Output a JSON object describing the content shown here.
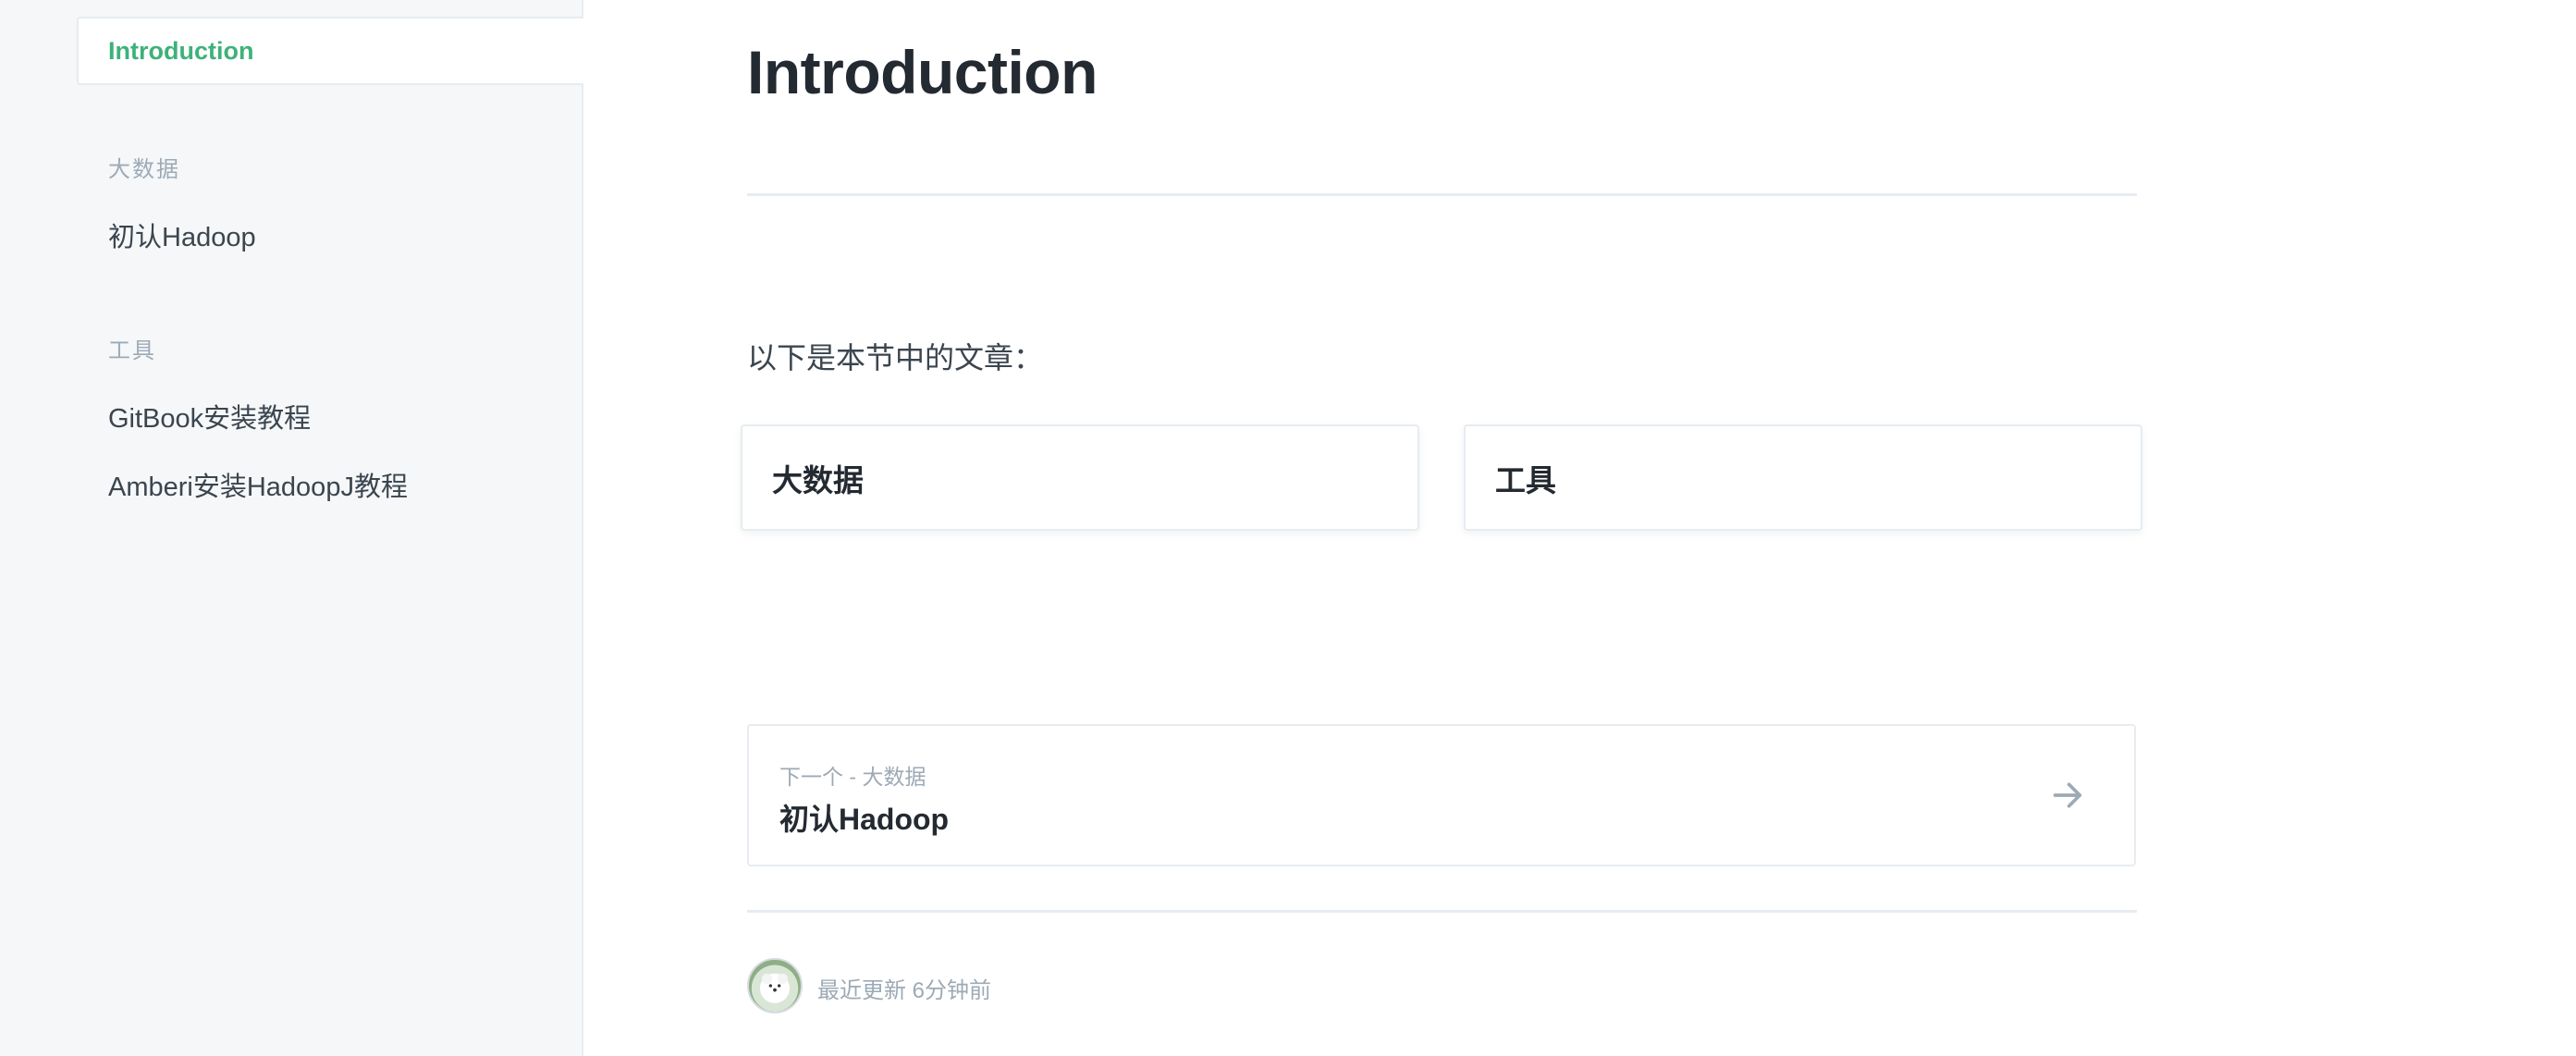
{
  "sidebar": {
    "active_item": "Introduction",
    "sections": [
      {
        "title": "大数据",
        "items": [
          "初认Hadoop"
        ]
      },
      {
        "title": "工具",
        "items": [
          "GitBook安装教程",
          "Amberi安装HadoopJ教程"
        ]
      }
    ]
  },
  "main": {
    "title": "Introduction",
    "intro_text": "以下是本节中的文章：",
    "cards": [
      "大数据",
      "工具"
    ],
    "next": {
      "hint": "下一个 - 大数据",
      "title": "初认Hadoop",
      "icon": "arrow-right-icon"
    },
    "footer": {
      "updated": "最近更新 6分钟前",
      "avatar_icon": "dog-avatar"
    }
  },
  "colors": {
    "accent": "#3eb17a",
    "sidebar_bg": "#f5f7f9",
    "border": "#e6ecf1",
    "muted_text": "#9daab6",
    "body_text": "#242a31"
  }
}
